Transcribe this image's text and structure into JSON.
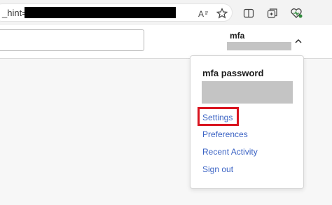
{
  "browser": {
    "address_text": "_hint=",
    "icons": [
      "read-aloud-icon",
      "favorite-star-icon",
      "split-screen-icon",
      "collections-icon",
      "browser-essentials-icon"
    ]
  },
  "header": {
    "user_name": "mfa"
  },
  "menu": {
    "title": "mfa password",
    "items": [
      {
        "label": "Settings"
      },
      {
        "label": "Preferences"
      },
      {
        "label": "Recent Activity"
      },
      {
        "label": "Sign out"
      }
    ]
  },
  "colors": {
    "link": "#3b63c4",
    "highlight": "#d9141f",
    "redaction": "#c4c4c4"
  }
}
